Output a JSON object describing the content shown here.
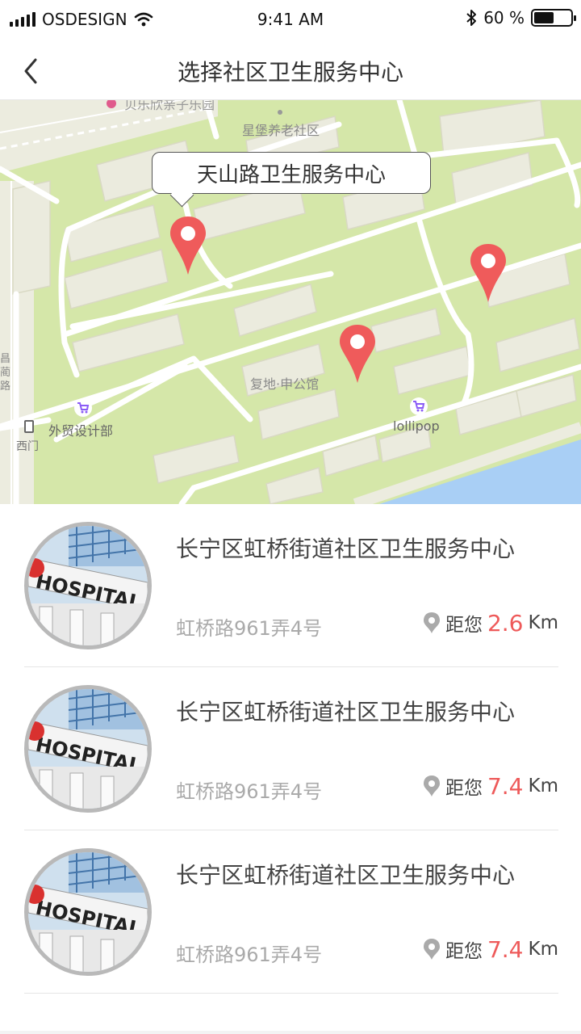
{
  "status_bar": {
    "carrier": "OSDESIGN",
    "time": "9:41 AM",
    "battery": "60 %",
    "battery_level": 0.6
  },
  "nav": {
    "title": "选择社区卫生服务中心"
  },
  "map": {
    "callout": "天山路卫生服务中心",
    "labels": {
      "top_park": "贝乐欣亲子乐园",
      "elderly": "星堡养老社区",
      "residence": "复地·申公馆",
      "lollipop": "lollipop",
      "trade": "外贸设计部",
      "west_gate": "西门",
      "road_v": "昌蔺路"
    },
    "colors": {
      "grass": "#d5e7a9",
      "road": "#ffffff",
      "building": "#ebebde",
      "water": "#a9cff5",
      "pin": "#ef5b5b"
    }
  },
  "list": {
    "items": [
      {
        "name": "长宁区虹桥街道社区卫生服务中心",
        "address": "虹桥路961弄4号",
        "dist_label": "距您",
        "distance": "2.6",
        "unit": "Km"
      },
      {
        "name": "长宁区虹桥街道社区卫生服务中心",
        "address": "虹桥路961弄4号",
        "dist_label": "距您",
        "distance": "7.4",
        "unit": "Km"
      },
      {
        "name": "长宁区虹桥街道社区卫生服务中心",
        "address": "虹桥路961弄4号",
        "dist_label": "距您",
        "distance": "7.4",
        "unit": "Km"
      }
    ],
    "avatar_text": "HOSPITAL"
  }
}
